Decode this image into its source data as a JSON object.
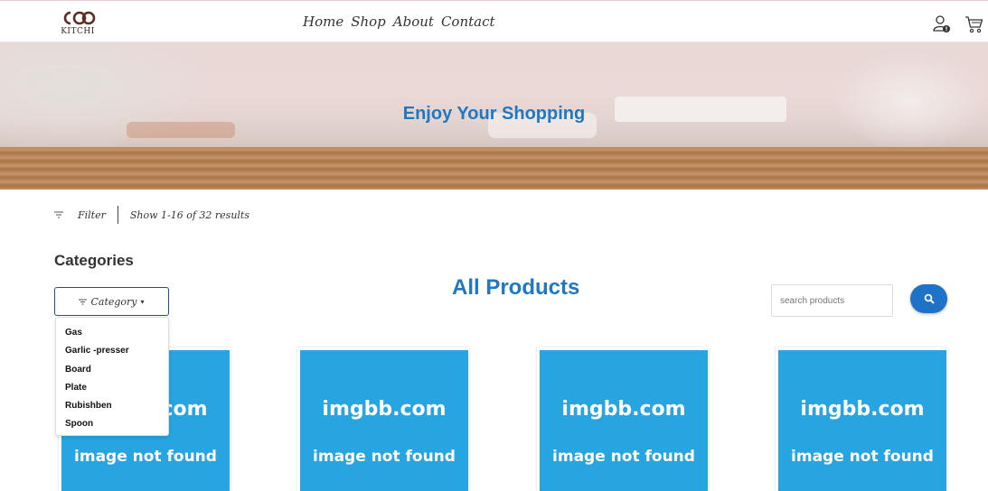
{
  "brand": {
    "name": "KITCHI"
  },
  "nav": {
    "links": [
      "Home",
      "Shop",
      "About",
      "Contact"
    ]
  },
  "header_icons": [
    "user-icon",
    "cart-icon"
  ],
  "hero": {
    "title": "Enjoy Your Shopping"
  },
  "filter_bar": {
    "filter_label": "Filter",
    "results_text": "Show 1-16 of 32 results"
  },
  "categories": {
    "heading": "Categories",
    "button_label": "Category",
    "items": [
      "Gas",
      "Garlic -presser",
      "Board",
      "Plate",
      "Rubishben",
      "Spoon"
    ]
  },
  "products": {
    "title": "All Products",
    "search_placeholder": "search products",
    "cards": [
      {
        "line1": "imgbb.com",
        "line2": "image not found"
      },
      {
        "line1": "imgbb.com",
        "line2": "image not found"
      },
      {
        "line1": "imgbb.com",
        "line2": "image not found"
      },
      {
        "line1": "imgbb.com",
        "line2": "image not found"
      }
    ]
  },
  "colors": {
    "accent": "#1f78c1",
    "button": "#1e73c9",
    "placeholder_image": "#27a5e1"
  }
}
